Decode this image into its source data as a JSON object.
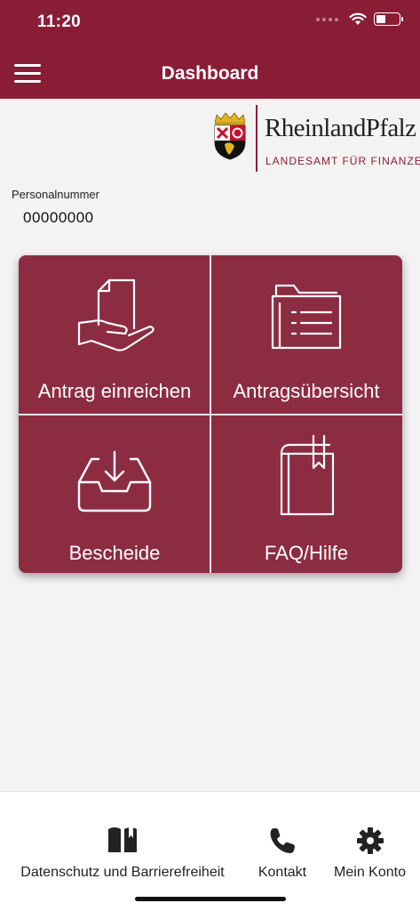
{
  "status_bar": {
    "time": "11:20"
  },
  "header": {
    "title": "Dashboard"
  },
  "logo": {
    "name": "RheinlandPfalz",
    "subtitle": "LANDESAMT FÜR FINANZEN"
  },
  "personal": {
    "label": "Personalnummer",
    "value": "00000000"
  },
  "tiles": [
    {
      "label": "Antrag einreichen",
      "icon": "hand-document-icon"
    },
    {
      "label": "Antragsübersicht",
      "icon": "folder-list-icon"
    },
    {
      "label": "Bescheide",
      "icon": "inbox-download-icon"
    },
    {
      "label": "FAQ/Hilfe",
      "icon": "book-bookmark-icon"
    }
  ],
  "bottom_nav": [
    {
      "label": "Datenschutz und Barrierefreiheit",
      "icon": "book-icon"
    },
    {
      "label": "Kontakt",
      "icon": "phone-icon"
    },
    {
      "label": "Mein Konto",
      "icon": "gear-icon"
    }
  ],
  "colors": {
    "brand": "#8a1d36",
    "tile": "#8c2c42",
    "background": "#f3f3f3"
  }
}
